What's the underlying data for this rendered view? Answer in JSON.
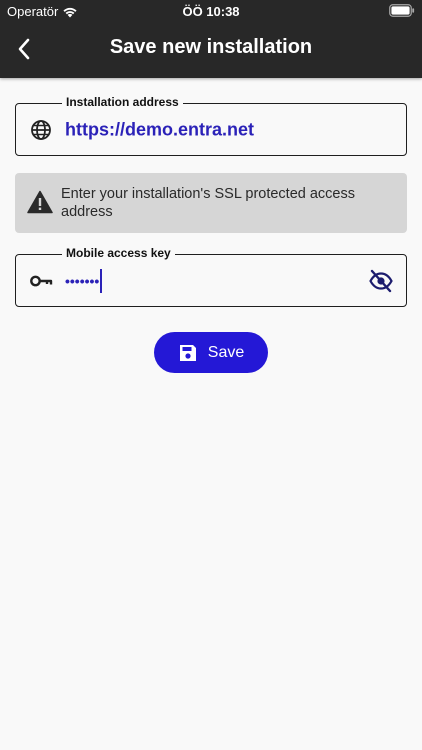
{
  "status_bar": {
    "carrier": "Operatör",
    "time": "ÖÖ 10:38"
  },
  "header": {
    "title": "Save new installation",
    "back_icon": "chevron-left-icon"
  },
  "address_field": {
    "label": "Installation address",
    "value": "https://demo.entra.net",
    "icon": "globe-icon"
  },
  "notice": {
    "text": "Enter your installation's SSL protected access address",
    "icon": "warning-icon"
  },
  "key_field": {
    "label": "Mobile access key",
    "value": "•••••••",
    "icon": "key-icon",
    "toggle_icon": "eye-off-icon"
  },
  "save_button": {
    "label": "Save",
    "icon": "floppy-disk-icon"
  },
  "colors": {
    "header_bg": "#282828",
    "accent": "#2418d6",
    "link_text": "#2b22b8",
    "notice_bg": "#d6d6d6",
    "page_bg": "#f9f9f9"
  }
}
